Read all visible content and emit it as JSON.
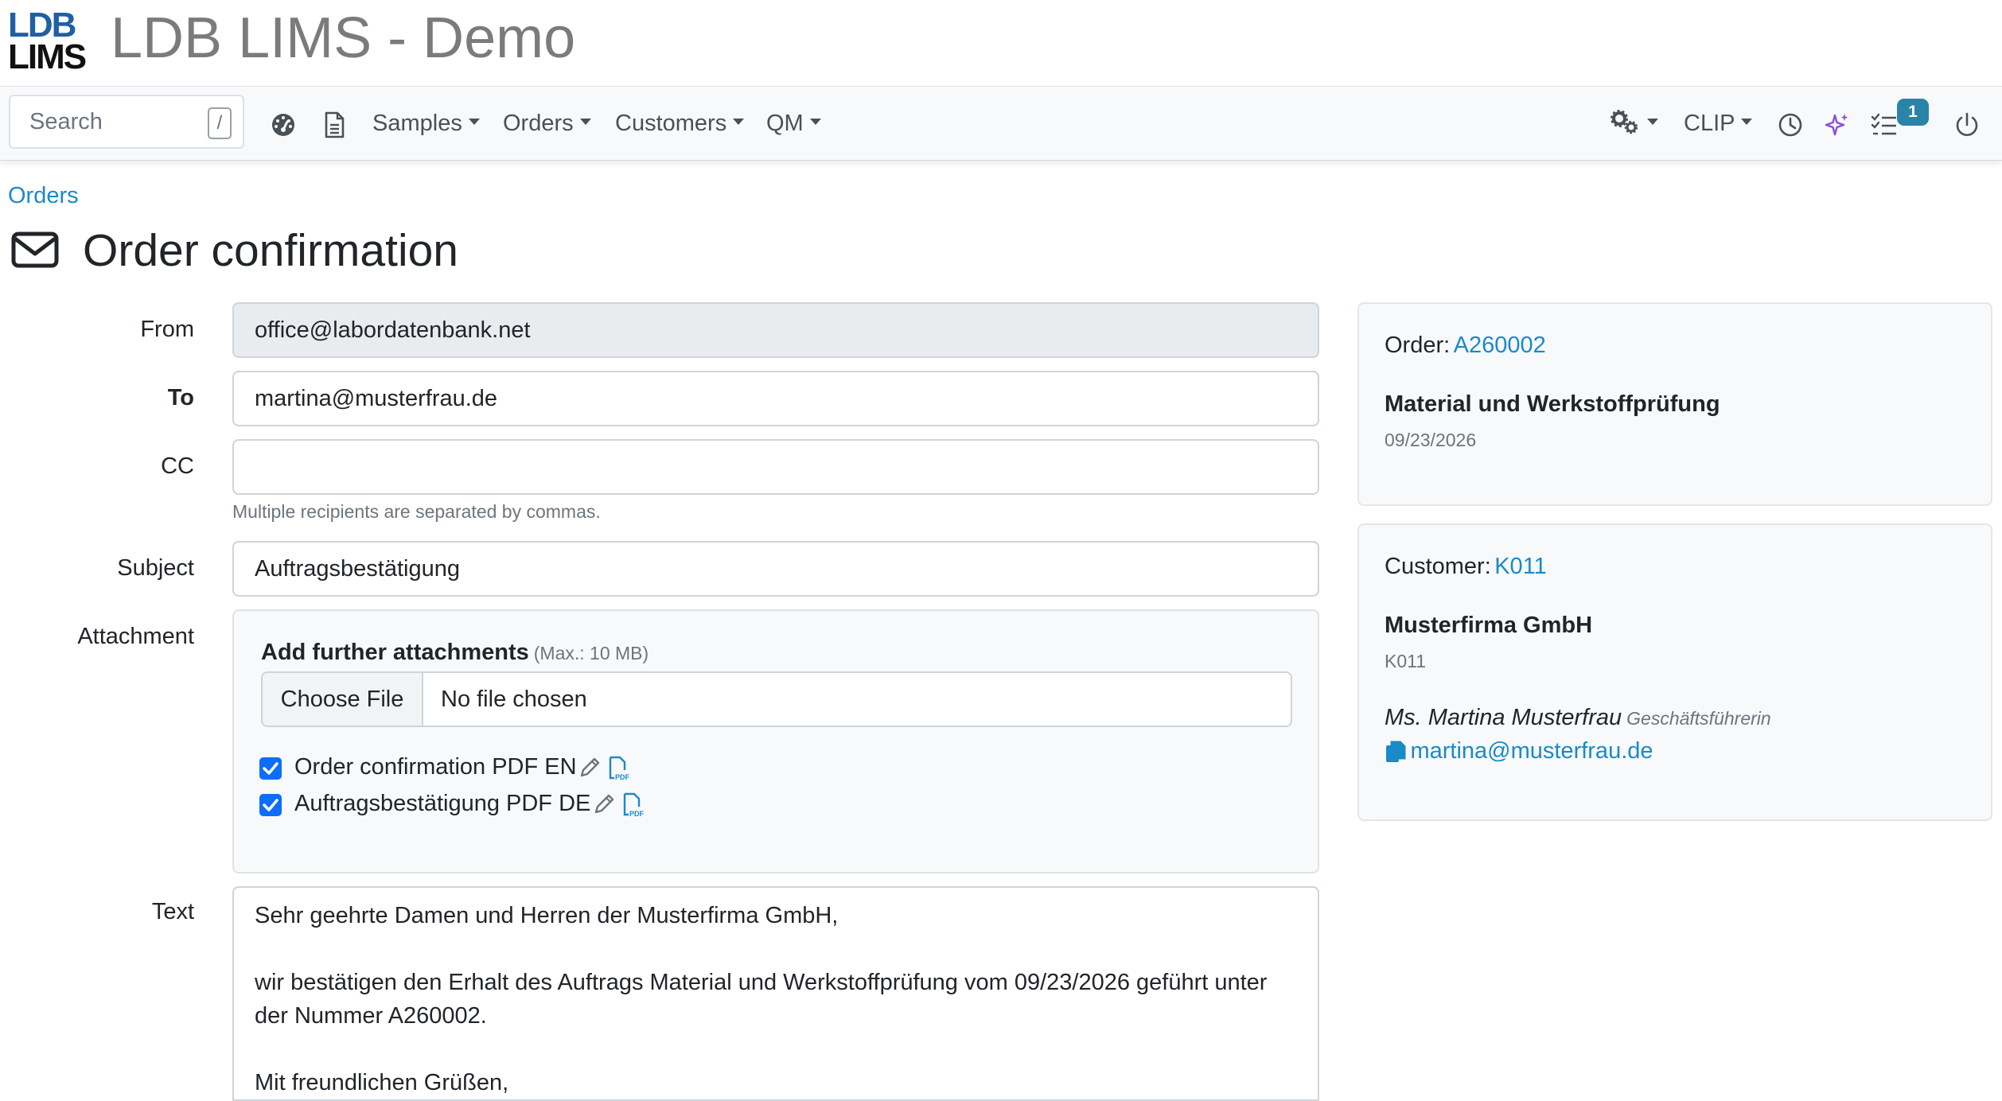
{
  "brand": {
    "logo_line1": "LDB",
    "logo_line2": "LIMS",
    "app_title": "LDB LIMS - Demo",
    "logo_color": "#1f5fa5"
  },
  "navbar": {
    "search_placeholder": "Search",
    "search_shortcut": "/",
    "menus": {
      "samples": "Samples",
      "orders": "Orders",
      "customers": "Customers",
      "qm": "QM",
      "clip": "CLIP"
    },
    "task_count": "1",
    "icons": [
      "dashboard-icon",
      "document-icon",
      "settings-gears-icon",
      "history-clock-icon",
      "ai-sparkle-icon",
      "tasks-list-icon",
      "power-icon"
    ]
  },
  "breadcrumb": "Orders",
  "page": {
    "title": "Order confirmation",
    "title_icon": "envelope-icon"
  },
  "form": {
    "from_label": "From",
    "from_value": "office@labordatenbank.net",
    "to_label": "To",
    "to_value": "martina@musterfrau.de",
    "cc_label": "CC",
    "cc_value": "",
    "cc_help": "Multiple recipients are separated by commas.",
    "subject_label": "Subject",
    "subject_value": "Auftragsbestätigung",
    "attachment_label": "Attachment",
    "attachments": {
      "title": "Add further attachments",
      "max": "(Max.: 10 MB)",
      "choose_file": "Choose File",
      "no_file": "No file chosen",
      "items": [
        {
          "label": "Order confirmation PDF EN",
          "checked": true
        },
        {
          "label": "Auftragsbestätigung PDF DE",
          "checked": true
        }
      ]
    },
    "text_label": "Text",
    "text_lines": [
      "Sehr geehrte Damen und Herren der Musterfirma GmbH,",
      "wir bestätigen den Erhalt des Auftrags Material und Werkstoffprüfung vom 09/23/2026 geführt unter der Nummer A260002.",
      "Mit freundlichen Grüßen,"
    ]
  },
  "order_card": {
    "label": "Order:",
    "order_id": "A260002",
    "name": "Material und Werkstoffprüfung",
    "date": "09/23/2026"
  },
  "customer_card": {
    "label": "Customer:",
    "customer_id": "K011",
    "name": "Musterfirma GmbH",
    "code": "K011",
    "contact_name": "Ms. Martina Musterfrau",
    "contact_role": "Geschäftsführerin",
    "contact_email": "martina@musterfrau.de"
  },
  "colors": {
    "link": "#1a8ac9",
    "checkbox": "#0d6efd",
    "badge": "#2b84a8",
    "ai_icon": "#8a4fd8"
  }
}
